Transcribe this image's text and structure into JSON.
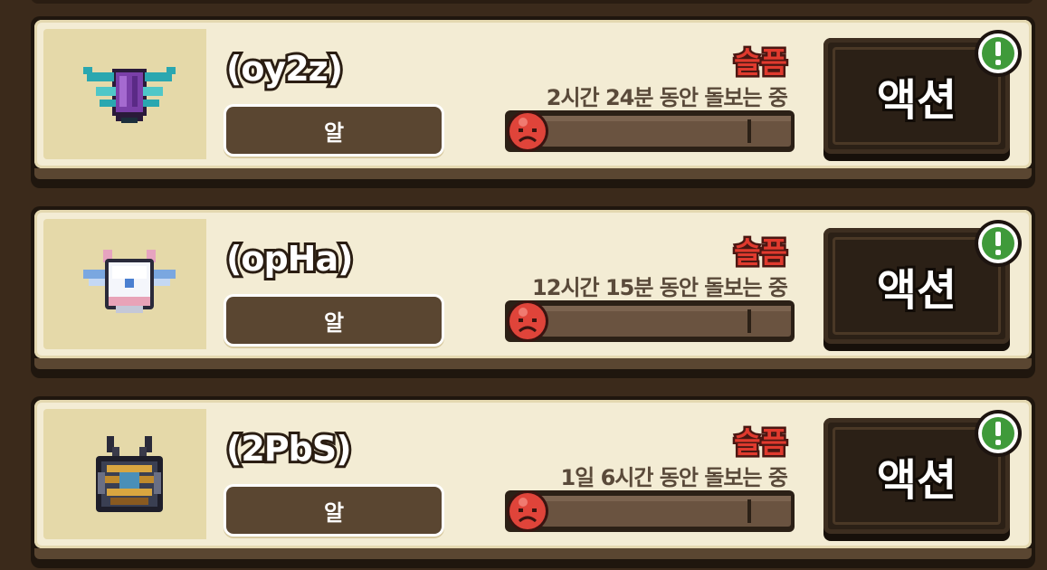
{
  "colors": {
    "background": "#3b2a1b",
    "card": "#f3ecd4",
    "mood_text": "#e03a2e",
    "alert_green": "#3f9a3a",
    "button": "#2b2016"
  },
  "pets": [
    {
      "name": "(oy2z)",
      "type": "알",
      "mood": "슬픔",
      "care_time": "2시간 24분 동안 돌보는 중",
      "mood_level": 0.0,
      "action_label": "액션",
      "alert_icon": "exclamation-alert-icon",
      "sprite": "purple-beetle-sprite"
    },
    {
      "name": "(opHa)",
      "type": "알",
      "mood": "슬픔",
      "care_time": "12시간 15분 동안 돌보는 중",
      "mood_level": 0.0,
      "action_label": "액션",
      "alert_icon": "exclamation-alert-icon",
      "sprite": "white-winged-cat-sprite"
    },
    {
      "name": "(2PbS)",
      "type": "알",
      "mood": "슬픔",
      "care_time": "1일 6시간 동안 돌보는 중",
      "mood_level": 0.0,
      "action_label": "액션",
      "alert_icon": "exclamation-alert-icon",
      "sprite": "horned-gold-armor-sprite"
    }
  ]
}
